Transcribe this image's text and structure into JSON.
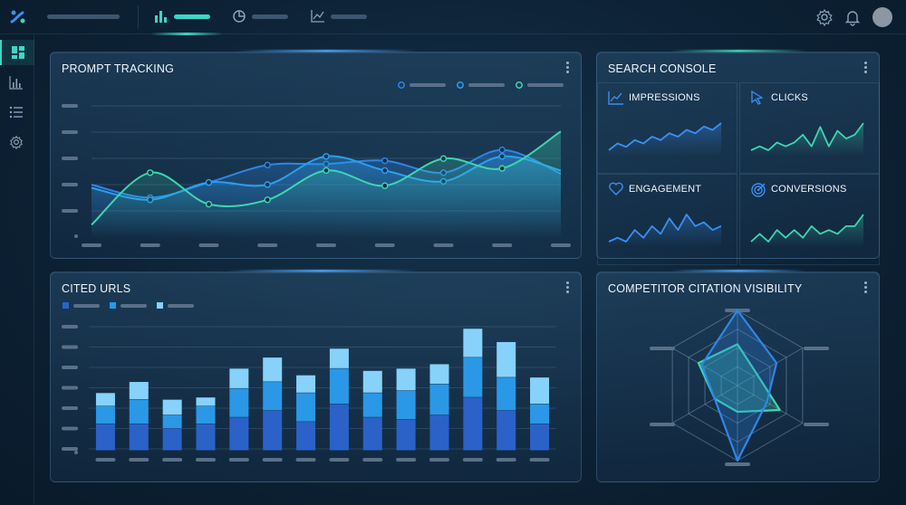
{
  "header": {
    "nav": [
      {
        "icon": "bar-chart-icon",
        "active": true
      },
      {
        "icon": "pie-chart-icon",
        "active": false
      },
      {
        "icon": "line-chart-icon",
        "active": false
      }
    ],
    "right_icons": [
      "settings-icon",
      "bell-icon",
      "user-avatar"
    ]
  },
  "sidebar": {
    "items": [
      {
        "icon": "dashboard-icon",
        "active": true
      },
      {
        "icon": "bar-chart-icon",
        "active": false
      },
      {
        "icon": "list-icon",
        "active": false
      },
      {
        "icon": "settings-icon",
        "active": false
      }
    ]
  },
  "prompt_tracking": {
    "title": "PROMPT TRACKING",
    "legend_colors": [
      "#2f86e6",
      "#3aa6f0",
      "#3ed6b0"
    ]
  },
  "search_console": {
    "title": "SEARCH CONSOLE",
    "metrics": [
      {
        "label": "IMPRESSIONS",
        "icon": "line-trend-icon",
        "color": "#3a8ff0",
        "values": [
          3,
          5,
          4,
          6,
          5,
          7,
          6,
          8,
          7,
          9,
          8,
          10,
          9,
          11
        ]
      },
      {
        "label": "CLICKS",
        "icon": "cursor-icon",
        "color": "#3ed6b0",
        "values": [
          3,
          4,
          3,
          5,
          4,
          5,
          7,
          4,
          9,
          4,
          8,
          6,
          7,
          10
        ]
      },
      {
        "label": "ENGAGEMENT",
        "icon": "heart-icon",
        "color": "#3a8ff0",
        "values": [
          2,
          3,
          2,
          5,
          3,
          6,
          4,
          8,
          5,
          9,
          6,
          7,
          5,
          6
        ]
      },
      {
        "label": "CONVERSIONS",
        "icon": "target-icon",
        "color": "#3ed6b0",
        "values": [
          2,
          4,
          2,
          5,
          3,
          5,
          3,
          6,
          4,
          5,
          4,
          6,
          6,
          9
        ]
      }
    ]
  },
  "cited_urls": {
    "title": "CITED URLS",
    "legend_colors": [
      "#2f6fd0",
      "#2a9ae8",
      "#7fd0ff"
    ]
  },
  "competitor": {
    "title": "COMPETITOR CITATION VISIBILITY"
  },
  "chart_data": [
    {
      "type": "line",
      "series_count": 3,
      "x": [
        0,
        1,
        2,
        3,
        4,
        5,
        6,
        7,
        8
      ],
      "series": [
        {
          "color": "#2f86e6",
          "values": [
            0.45,
            0.33,
            0.47,
            0.63,
            0.64,
            0.67,
            0.56,
            0.77,
            0.55
          ]
        },
        {
          "color": "#2aa0ee",
          "values": [
            0.42,
            0.31,
            0.47,
            0.45,
            0.71,
            0.58,
            0.48,
            0.71,
            0.58
          ]
        },
        {
          "color": "#3ed6b0",
          "values": [
            0.08,
            0.56,
            0.27,
            0.31,
            0.58,
            0.44,
            0.69,
            0.6,
            0.94
          ]
        }
      ]
    },
    {
      "type": "bar",
      "stacked": true,
      "categories": [
        "1",
        "2",
        "3",
        "4",
        "5",
        "6",
        "7",
        "8",
        "9",
        "10",
        "11",
        "12",
        "13",
        "14"
      ],
      "series": [
        {
          "color": "#2a62c8",
          "values": [
            1.2,
            1.2,
            1.0,
            1.2,
            1.5,
            1.8,
            1.3,
            2.1,
            1.5,
            1.4,
            1.6,
            2.4,
            1.8,
            1.2
          ]
        },
        {
          "color": "#2a98e6",
          "values": [
            0.8,
            1.1,
            0.6,
            0.8,
            1.3,
            1.3,
            1.3,
            1.6,
            1.1,
            1.3,
            1.4,
            1.8,
            1.5,
            0.9
          ]
        },
        {
          "color": "#86d2fb",
          "values": [
            0.6,
            0.8,
            0.7,
            0.4,
            0.9,
            1.1,
            0.8,
            0.9,
            1.0,
            1.0,
            0.9,
            1.3,
            1.6,
            1.2
          ]
        }
      ]
    },
    {
      "type": "radar",
      "axes": 6,
      "series": [
        {
          "color": "#3ed6b0",
          "values": [
            0.55,
            0.3,
            0.65,
            0.35,
            0.35,
            0.6
          ]
        },
        {
          "color": "#2f86e6",
          "values": [
            1.0,
            0.6,
            0.45,
            1.0,
            0.35,
            0.55
          ]
        }
      ]
    }
  ]
}
